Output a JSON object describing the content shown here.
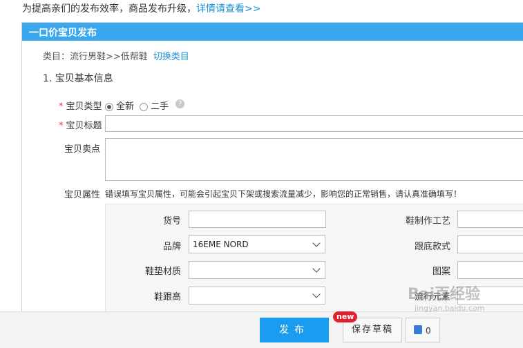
{
  "notice": {
    "text": "为提高亲们的发布效率，商品发布升级，",
    "link": "详情请查看>>"
  },
  "panel": {
    "title": "一口价宝贝发布",
    "category_label": "类目：流行男鞋>>低帮鞋",
    "switch_category": "切换类目",
    "section_title": "1. 宝贝基本信息"
  },
  "form": {
    "type_label": "宝贝类型",
    "type_options": [
      "全新",
      "二手"
    ],
    "type_selected": "全新",
    "title_label": "宝贝标题",
    "title_value": "",
    "selling_label": "宝贝卖点",
    "selling_value": "",
    "attr_label": "宝贝属性",
    "attr_note": "错误填写宝贝属性，可能会引起宝贝下架或搜索流量减少，影响您的正常销售，请认真准确填写！",
    "required_mark": "*",
    "help_glyph": "?"
  },
  "attributes": {
    "huohao": {
      "label": "货号",
      "value": ""
    },
    "pinpai": {
      "label": "品牌",
      "value": "16EME NORD"
    },
    "xiedian": {
      "label": "鞋垫材质",
      "value": ""
    },
    "xiegen": {
      "label": "鞋跟高",
      "value": ""
    },
    "zhizuo": {
      "label": "鞋制作工艺",
      "value": ""
    },
    "gendi": {
      "label": "跟底款式",
      "value": ""
    },
    "tuan": {
      "label": "图案",
      "value": ""
    },
    "liuxing": {
      "label": "流行元素",
      "value": ""
    }
  },
  "footer": {
    "publish": "发布",
    "save_draft": "保存草稿",
    "new_badge": "new",
    "preview_glyph": "0"
  },
  "watermark": {
    "text": "Bai百经验",
    "sub": "jingyan.baidu.com"
  },
  "colors": {
    "header_blue": "#3aa7ee",
    "button_blue": "#1a9cf0",
    "link_blue": "#1a8fd8",
    "required_red": "#e4393c",
    "badge_red": "#e3202e"
  }
}
